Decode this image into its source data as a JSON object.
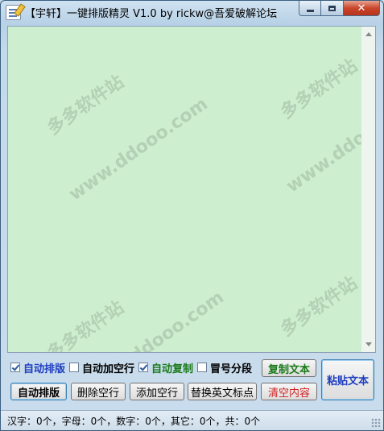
{
  "window": {
    "title": "【宇轩】一键排版精灵 V1.0 by rickw@吾爱破解论坛"
  },
  "watermark": {
    "site": "多多软件站",
    "url": "www.ddooo.com"
  },
  "options": {
    "auto_layout": {
      "label": "自动排版",
      "checked": true
    },
    "auto_blank_line": {
      "label": "自动加空行",
      "checked": false
    },
    "auto_copy": {
      "label": "自动复制",
      "checked": true
    },
    "colon_paragraph": {
      "label": "冒号分段",
      "checked": false
    }
  },
  "buttons": {
    "copy_text": "复制文本",
    "paste_text": "粘贴文本",
    "auto_layout": "自动排版",
    "delete_blank": "删除空行",
    "add_blank": "添加空行",
    "replace_punct": "替换英文标点",
    "clear": "清空内容"
  },
  "status": {
    "text": "汉字：0个，字母：0个，数字：0个，其它：0个，共：0个"
  },
  "colors": {
    "blue": "#1e3ec0",
    "green": "#1a7a1a",
    "red": "#d42020",
    "editor_bg": "#cdefcf"
  }
}
